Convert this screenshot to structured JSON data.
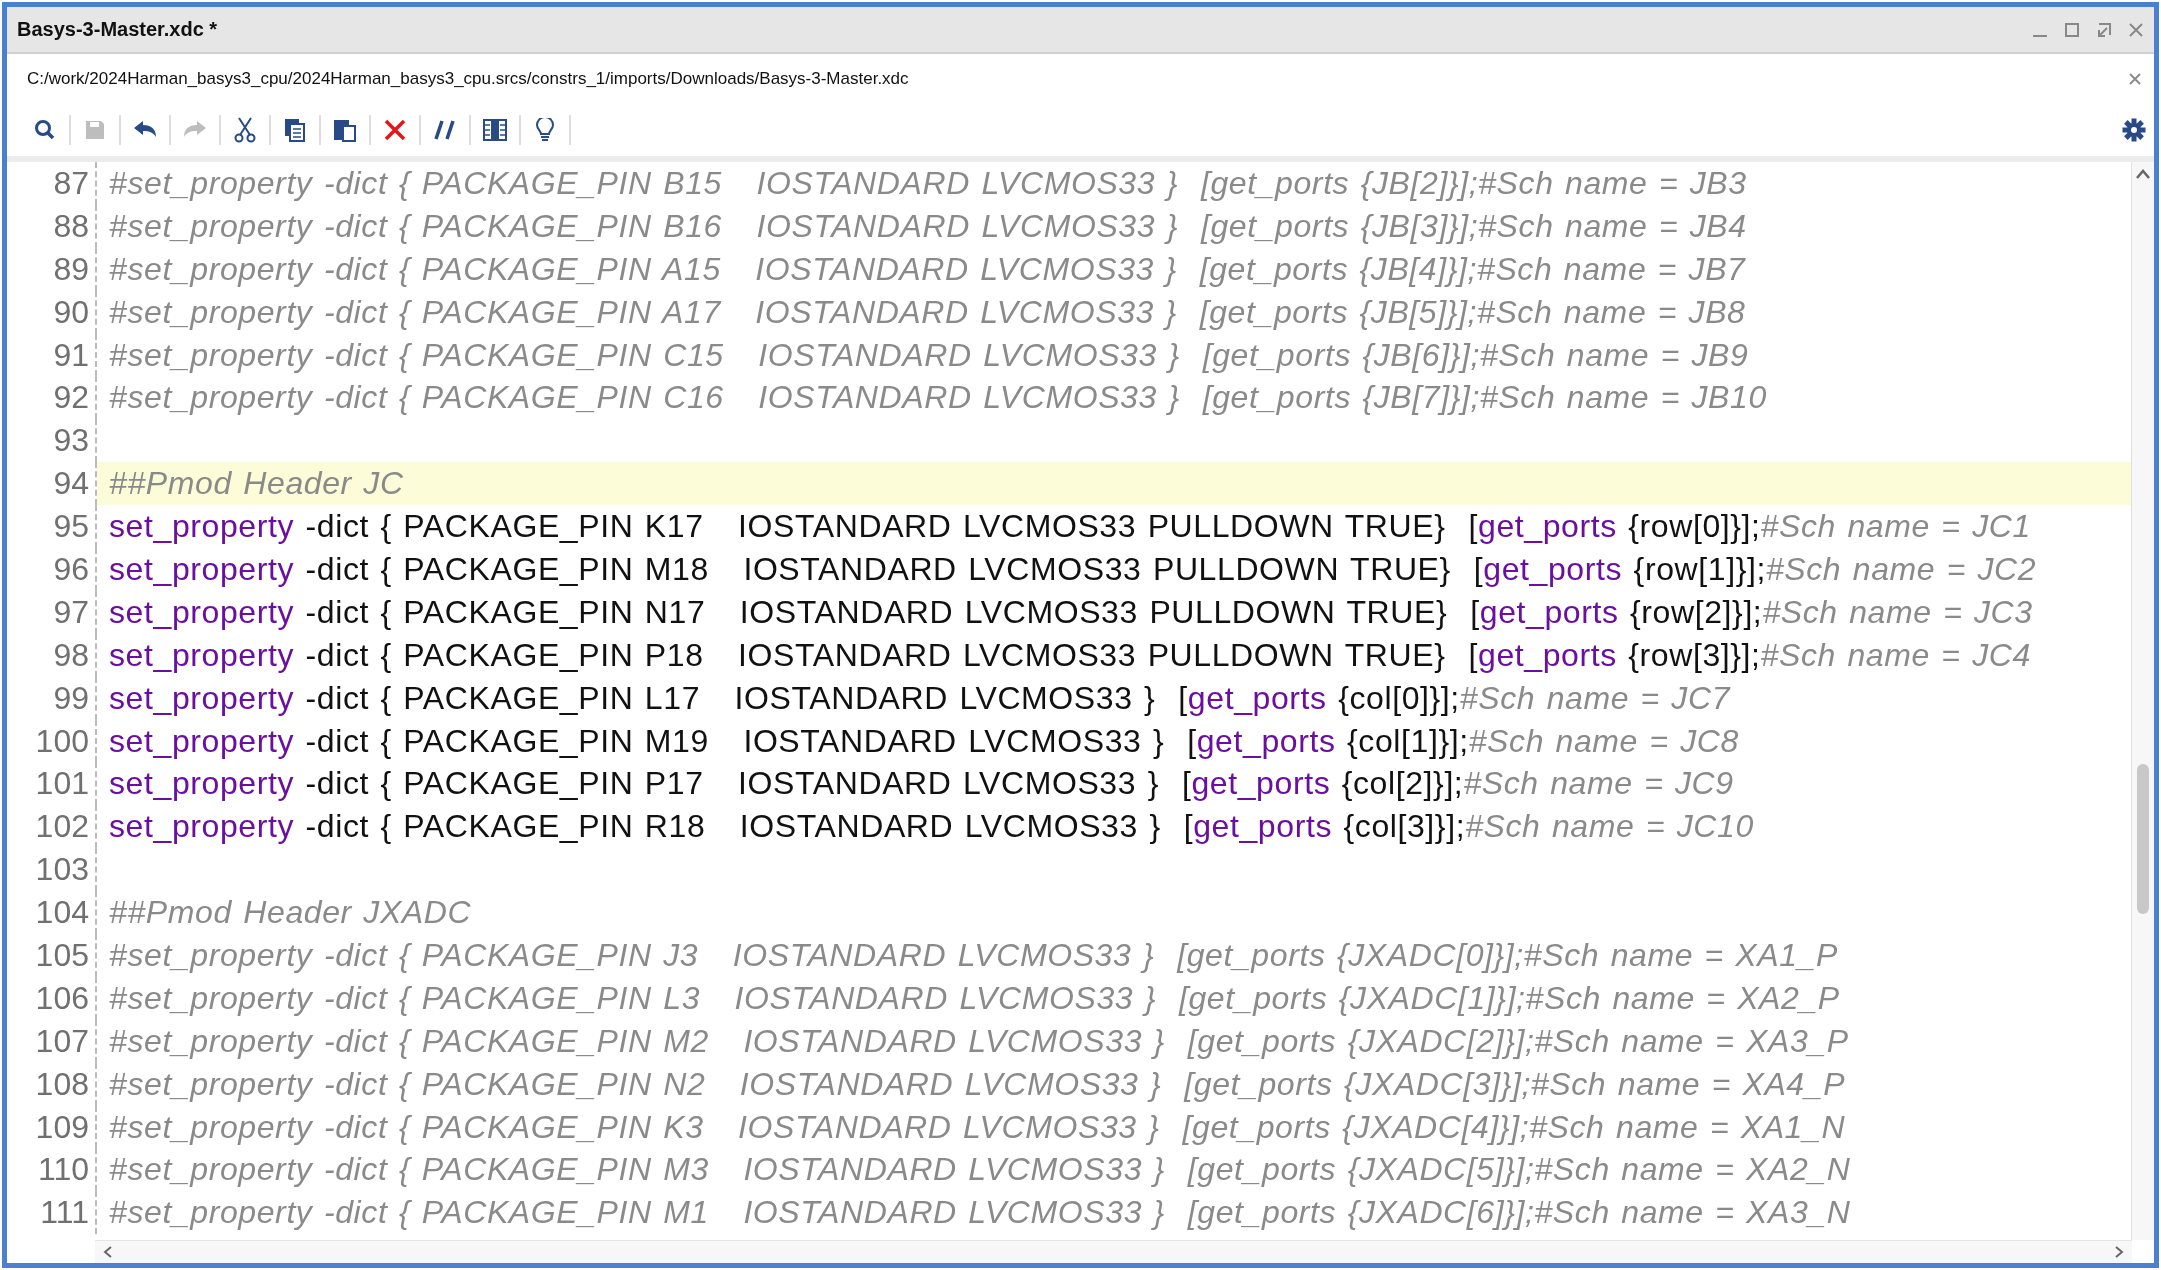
{
  "window": {
    "title": "Basys-3-Master.xdc *"
  },
  "file_path": "C:/work/2024Harman_basys3_cpu/2024Harman_basys3_cpu.srcs/constrs_1/imports/Downloads/Basys-3-Master.xdc",
  "toolbar": [
    {
      "kind": "search",
      "disabled": false
    },
    {
      "kind": "save",
      "disabled": true
    },
    {
      "kind": "undo",
      "disabled": false
    },
    {
      "kind": "redo",
      "disabled": true
    },
    {
      "kind": "cut",
      "disabled": false
    },
    {
      "kind": "copy",
      "disabled": false
    },
    {
      "kind": "paste",
      "disabled": false
    },
    {
      "kind": "delete",
      "disabled": false
    },
    {
      "kind": "comment",
      "disabled": false
    },
    {
      "kind": "columns",
      "disabled": false
    },
    {
      "kind": "hint",
      "disabled": false
    }
  ],
  "editor": {
    "lines": [
      {
        "number": "87",
        "highlighted": false,
        "segments": [
          {
            "kind": "comment",
            "text": "#set_property -dict { PACKAGE_PIN B15   IOSTANDARD LVCMOS33 }  [get_ports {JB[2]}];#Sch name = JB3"
          }
        ]
      },
      {
        "number": "88",
        "highlighted": false,
        "segments": [
          {
            "kind": "comment",
            "text": "#set_property -dict { PACKAGE_PIN B16   IOSTANDARD LVCMOS33 }  [get_ports {JB[3]}];#Sch name = JB4"
          }
        ]
      },
      {
        "number": "89",
        "highlighted": false,
        "segments": [
          {
            "kind": "comment",
            "text": "#set_property -dict { PACKAGE_PIN A15   IOSTANDARD LVCMOS33 }  [get_ports {JB[4]}];#Sch name = JB7"
          }
        ]
      },
      {
        "number": "90",
        "highlighted": false,
        "segments": [
          {
            "kind": "comment",
            "text": "#set_property -dict { PACKAGE_PIN A17   IOSTANDARD LVCMOS33 }  [get_ports {JB[5]}];#Sch name = JB8"
          }
        ]
      },
      {
        "number": "91",
        "highlighted": false,
        "segments": [
          {
            "kind": "comment",
            "text": "#set_property -dict { PACKAGE_PIN C15   IOSTANDARD LVCMOS33 }  [get_ports {JB[6]}];#Sch name = JB9"
          }
        ]
      },
      {
        "number": "92",
        "highlighted": false,
        "segments": [
          {
            "kind": "comment",
            "text": "#set_property -dict { PACKAGE_PIN C16   IOSTANDARD LVCMOS33 }  [get_ports {JB[7]}];#Sch name = JB10"
          }
        ]
      },
      {
        "number": "93",
        "highlighted": false
      },
      {
        "number": "94",
        "highlighted": true,
        "segments": [
          {
            "kind": "comment",
            "text": "##Pmod Header JC"
          }
        ]
      },
      {
        "number": "95",
        "highlighted": false,
        "segments": [
          {
            "kind": "keyword",
            "text": "set_property"
          },
          {
            "kind": "plain",
            "text": " -dict { PACKAGE_PIN K17   IOSTANDARD LVCMOS33 PULLDOWN TRUE}  ["
          },
          {
            "kind": "keyword",
            "text": "get_ports"
          },
          {
            "kind": "plain",
            "text": " {row[0]}];"
          },
          {
            "kind": "comment",
            "text": "#Sch name = JC1"
          }
        ]
      },
      {
        "number": "96",
        "highlighted": false,
        "segments": [
          {
            "kind": "keyword",
            "text": "set_property"
          },
          {
            "kind": "plain",
            "text": " -dict { PACKAGE_PIN M18   IOSTANDARD LVCMOS33 PULLDOWN TRUE}  ["
          },
          {
            "kind": "keyword",
            "text": "get_ports"
          },
          {
            "kind": "plain",
            "text": " {row[1]}];"
          },
          {
            "kind": "comment",
            "text": "#Sch name = JC2"
          }
        ]
      },
      {
        "number": "97",
        "highlighted": false,
        "segments": [
          {
            "kind": "keyword",
            "text": "set_property"
          },
          {
            "kind": "plain",
            "text": " -dict { PACKAGE_PIN N17   IOSTANDARD LVCMOS33 PULLDOWN TRUE}  ["
          },
          {
            "kind": "keyword",
            "text": "get_ports"
          },
          {
            "kind": "plain",
            "text": " {row[2]}];"
          },
          {
            "kind": "comment",
            "text": "#Sch name = JC3"
          }
        ]
      },
      {
        "number": "98",
        "highlighted": false,
        "segments": [
          {
            "kind": "keyword",
            "text": "set_property"
          },
          {
            "kind": "plain",
            "text": " -dict { PACKAGE_PIN P18   IOSTANDARD LVCMOS33 PULLDOWN TRUE}  ["
          },
          {
            "kind": "keyword",
            "text": "get_ports"
          },
          {
            "kind": "plain",
            "text": " {row[3]}];"
          },
          {
            "kind": "comment",
            "text": "#Sch name = JC4"
          }
        ]
      },
      {
        "number": "99",
        "highlighted": false,
        "segments": [
          {
            "kind": "keyword",
            "text": "set_property"
          },
          {
            "kind": "plain",
            "text": " -dict { PACKAGE_PIN L17   IOSTANDARD LVCMOS33 }  ["
          },
          {
            "kind": "keyword",
            "text": "get_ports"
          },
          {
            "kind": "plain",
            "text": " {col[0]}];"
          },
          {
            "kind": "comment",
            "text": "#Sch name = JC7"
          }
        ]
      },
      {
        "number": "100",
        "highlighted": false,
        "segments": [
          {
            "kind": "keyword",
            "text": "set_property"
          },
          {
            "kind": "plain",
            "text": " -dict { PACKAGE_PIN M19   IOSTANDARD LVCMOS33 }  ["
          },
          {
            "kind": "keyword",
            "text": "get_ports"
          },
          {
            "kind": "plain",
            "text": " {col[1]}];"
          },
          {
            "kind": "comment",
            "text": "#Sch name = JC8"
          }
        ]
      },
      {
        "number": "101",
        "highlighted": false,
        "segments": [
          {
            "kind": "keyword",
            "text": "set_property"
          },
          {
            "kind": "plain",
            "text": " -dict { PACKAGE_PIN P17   IOSTANDARD LVCMOS33 }  ["
          },
          {
            "kind": "keyword",
            "text": "get_ports"
          },
          {
            "kind": "plain",
            "text": " {col[2]}];"
          },
          {
            "kind": "comment",
            "text": "#Sch name = JC9"
          }
        ]
      },
      {
        "number": "102",
        "highlighted": false,
        "segments": [
          {
            "kind": "keyword",
            "text": "set_property"
          },
          {
            "kind": "plain",
            "text": " -dict { PACKAGE_PIN R18   IOSTANDARD LVCMOS33 }  ["
          },
          {
            "kind": "keyword",
            "text": "get_ports"
          },
          {
            "kind": "plain",
            "text": " {col[3]}];"
          },
          {
            "kind": "comment",
            "text": "#Sch name = JC10"
          }
        ]
      },
      {
        "number": "103",
        "highlighted": false
      },
      {
        "number": "104",
        "highlighted": false,
        "segments": [
          {
            "kind": "comment",
            "text": "##Pmod Header JXADC"
          }
        ]
      },
      {
        "number": "105",
        "highlighted": false,
        "segments": [
          {
            "kind": "comment",
            "text": "#set_property -dict { PACKAGE_PIN J3   IOSTANDARD LVCMOS33 }  [get_ports {JXADC[0]}];#Sch name = XA1_P"
          }
        ]
      },
      {
        "number": "106",
        "highlighted": false,
        "segments": [
          {
            "kind": "comment",
            "text": "#set_property -dict { PACKAGE_PIN L3   IOSTANDARD LVCMOS33 }  [get_ports {JXADC[1]}];#Sch name = XA2_P"
          }
        ]
      },
      {
        "number": "107",
        "highlighted": false,
        "segments": [
          {
            "kind": "comment",
            "text": "#set_property -dict { PACKAGE_PIN M2   IOSTANDARD LVCMOS33 }  [get_ports {JXADC[2]}];#Sch name = XA3_P"
          }
        ]
      },
      {
        "number": "108",
        "highlighted": false,
        "segments": [
          {
            "kind": "comment",
            "text": "#set_property -dict { PACKAGE_PIN N2   IOSTANDARD LVCMOS33 }  [get_ports {JXADC[3]}];#Sch name = XA4_P"
          }
        ]
      },
      {
        "number": "109",
        "highlighted": false,
        "segments": [
          {
            "kind": "comment",
            "text": "#set_property -dict { PACKAGE_PIN K3   IOSTANDARD LVCMOS33 }  [get_ports {JXADC[4]}];#Sch name = XA1_N"
          }
        ]
      },
      {
        "number": "110",
        "highlighted": false,
        "segments": [
          {
            "kind": "comment",
            "text": "#set_property -dict { PACKAGE_PIN M3   IOSTANDARD LVCMOS33 }  [get_ports {JXADC[5]}];#Sch name = XA2_N"
          }
        ]
      },
      {
        "number": "111",
        "highlighted": false,
        "segments": [
          {
            "kind": "comment",
            "text": "#set_property -dict { PACKAGE_PIN M1   IOSTANDARD LVCMOS33 }  [get_ports {JXADC[6]}];#Sch name = XA3_N"
          }
        ]
      }
    ]
  }
}
